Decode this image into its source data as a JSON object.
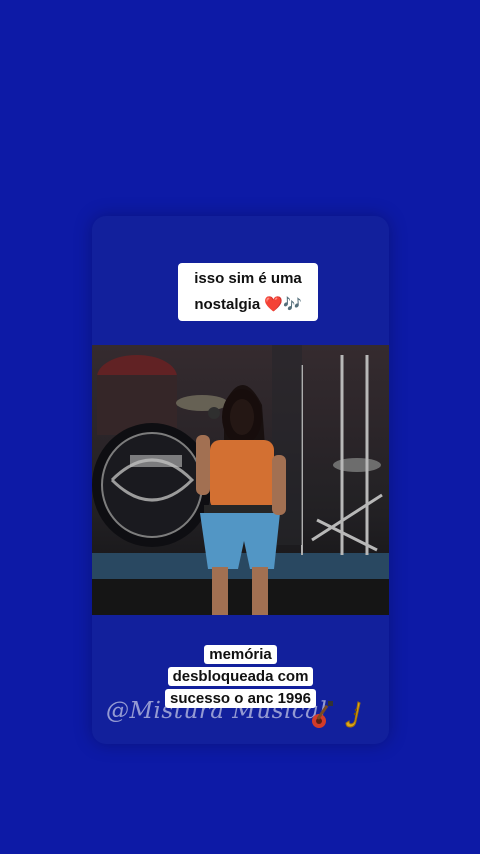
{
  "captions": {
    "top": "isso sim é uma nostalgia ❤️🎶",
    "bottom": "memória desbloqueada com sucesso o anc 1996"
  },
  "watermark": "@Mistura Musical",
  "icons": [
    "guitar-icon",
    "saxophone-icon"
  ],
  "colors": {
    "background": "#0d1aa6",
    "card": "#12209c"
  }
}
